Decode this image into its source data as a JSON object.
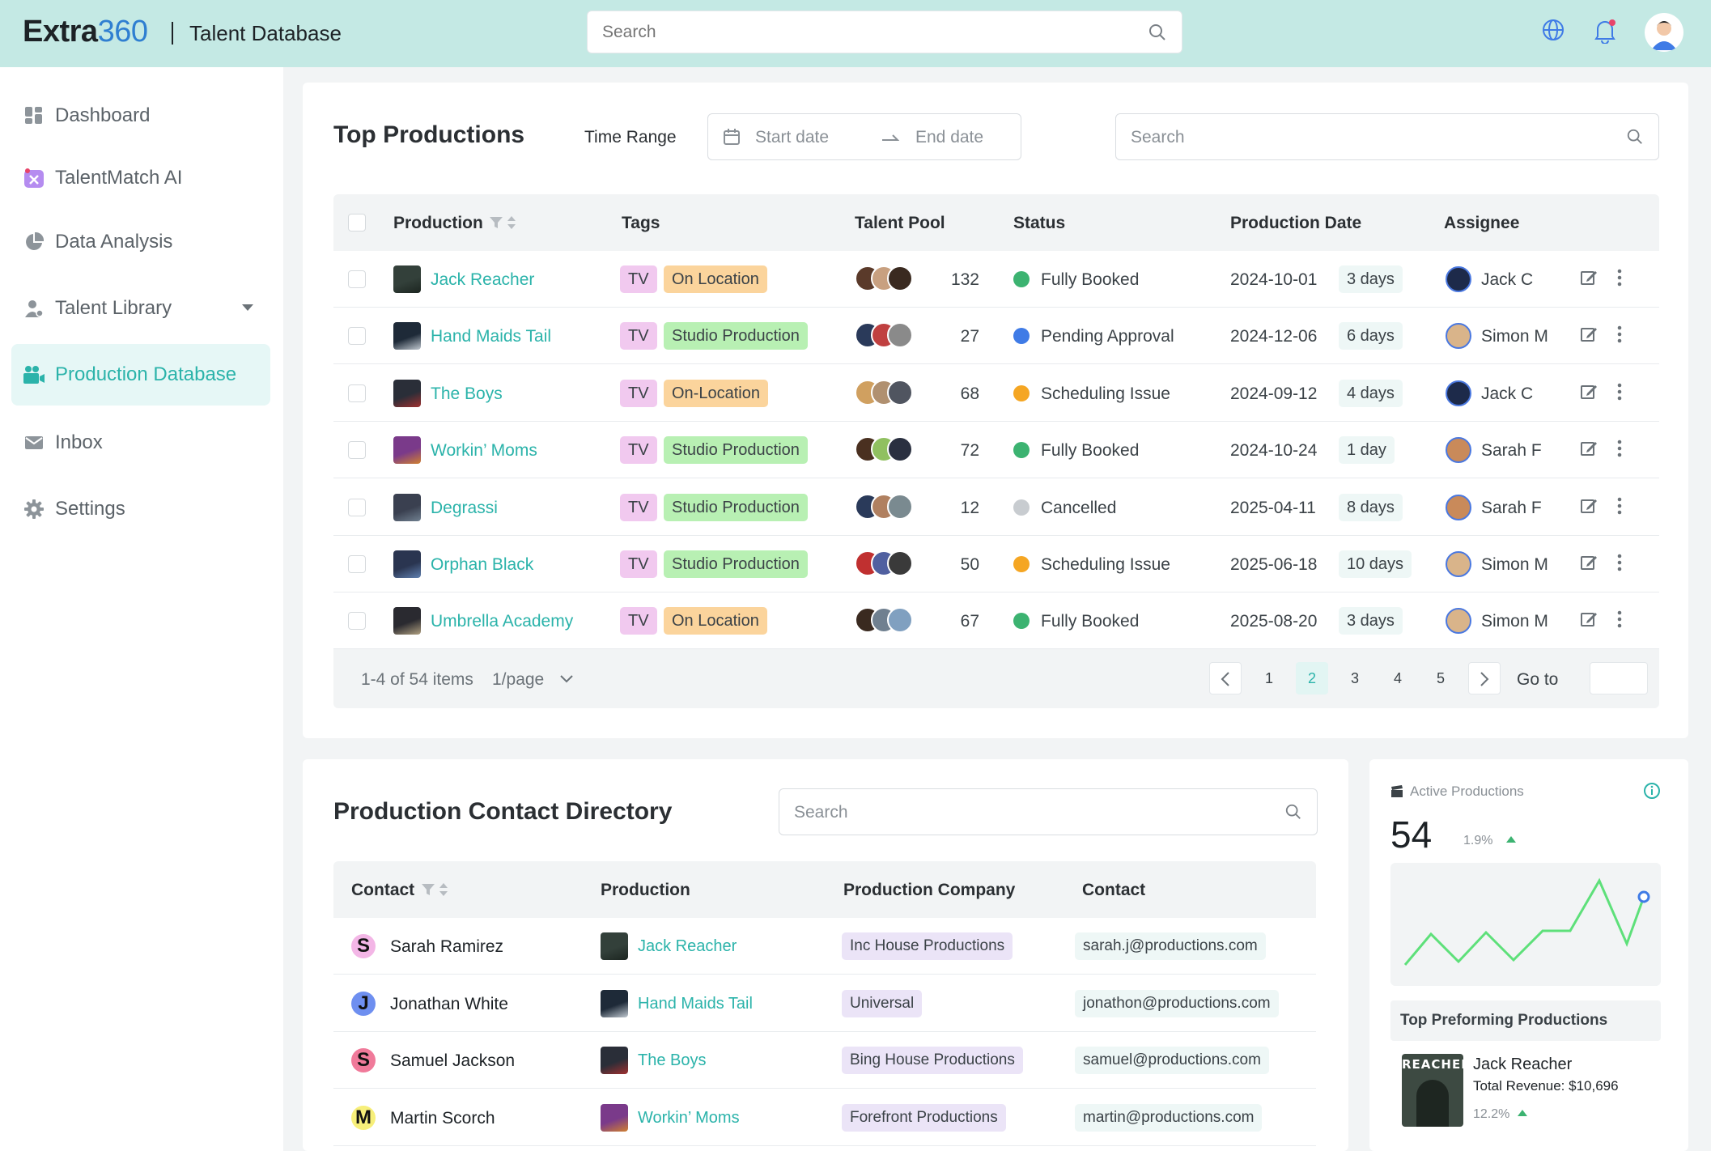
{
  "header": {
    "brand_text": "Extra",
    "brand_num": "360",
    "section": "Talent Database",
    "search_placeholder": "Search"
  },
  "sidebar": {
    "items": [
      {
        "label": "Dashboard",
        "icon": "dashboard-icon"
      },
      {
        "label": "TalentMatch AI",
        "icon": "ai-icon"
      },
      {
        "label": "Data Analysis",
        "icon": "pie-chart-icon"
      },
      {
        "label": "Talent Library",
        "icon": "person-icon"
      },
      {
        "label": "Production Database",
        "icon": "camera-icon"
      },
      {
        "label": "Inbox",
        "icon": "mail-icon"
      },
      {
        "label": "Settings",
        "icon": "gear-icon"
      }
    ]
  },
  "top_productions": {
    "title": "Top Productions",
    "time_range_label": "Time Range",
    "start_placeholder": "Start date",
    "end_placeholder": "End date",
    "search_placeholder": "Search",
    "columns": [
      "Production",
      "Tags",
      "Talent Pool",
      "Status",
      "Production Date",
      "Assignee"
    ],
    "rows": [
      {
        "production": "Jack Reacher",
        "tag1": "TV",
        "tag2": "On Location",
        "tag2_type": "loc",
        "pool": "132",
        "status": "Fully Booked",
        "status_type": "ok",
        "date": "2024-10-01",
        "days": "3 days",
        "assignee": "Jack C"
      },
      {
        "production": "Hand Maids Tail",
        "tag1": "TV",
        "tag2": "Studio Production",
        "tag2_type": "studio",
        "pool": "27",
        "status": "Pending Approval",
        "status_type": "pending",
        "date": "2024-12-06",
        "days": "6 days",
        "assignee": "Simon M"
      },
      {
        "production": "The Boys",
        "tag1": "TV",
        "tag2": "On-Location",
        "tag2_type": "loc",
        "pool": "68",
        "status": "Scheduling Issue",
        "status_type": "warn",
        "date": "2024-09-12",
        "days": "4 days",
        "assignee": "Jack C"
      },
      {
        "production": "Workin’ Moms",
        "tag1": "TV",
        "tag2": "Studio Production",
        "tag2_type": "studio",
        "pool": "72",
        "status": "Fully Booked",
        "status_type": "ok",
        "date": "2024-10-24",
        "days": "1 day",
        "assignee": "Sarah F"
      },
      {
        "production": "Degrassi",
        "tag1": "TV",
        "tag2": "Studio Production",
        "tag2_type": "studio",
        "pool": "12",
        "status": "Cancelled",
        "status_type": "cancel",
        "date": "2025-04-11",
        "days": "8 days",
        "assignee": "Sarah F"
      },
      {
        "production": "Orphan Black",
        "tag1": "TV",
        "tag2": "Studio Production",
        "tag2_type": "studio",
        "pool": "50",
        "status": "Scheduling Issue",
        "status_type": "warn",
        "date": "2025-06-18",
        "days": "10 days",
        "assignee": "Simon M"
      },
      {
        "production": "Umbrella Academy",
        "tag1": "TV",
        "tag2": "On Location",
        "tag2_type": "loc",
        "pool": "67",
        "status": "Fully Booked",
        "status_type": "ok",
        "date": "2025-08-20",
        "days": "3 days",
        "assignee": "Simon M"
      }
    ],
    "footer": {
      "range": "1-4 of 54 items",
      "per_page": "1/page",
      "pages": [
        "1",
        "2",
        "3",
        "4",
        "5"
      ],
      "current_page": "2",
      "goto": "Go to"
    }
  },
  "contacts": {
    "title": "Production Contact Directory",
    "search_placeholder": "Search",
    "columns": [
      "Contact",
      "Production",
      "Production Company",
      "Contact"
    ],
    "rows": [
      {
        "initial": "S",
        "name": "Sarah Ramirez",
        "production": "Jack Reacher",
        "company": "Inc House Productions",
        "email": "sarah.j@productions.com",
        "color": "#f3b6e6"
      },
      {
        "initial": "J",
        "name": "Jonathan White",
        "production": "Hand Maids Tail",
        "company": "Universal",
        "email": "jonathon@productions.com",
        "color": "#6e8ff0"
      },
      {
        "initial": "S",
        "name": "Samuel Jackson",
        "production": "The Boys",
        "company": "Bing House Productions",
        "email": "samuel@productions.com",
        "color": "#f07a9a"
      },
      {
        "initial": "M",
        "name": "Martin Scorch",
        "production": "Workin’ Moms",
        "company": "Forefront Productions",
        "email": "martin@productions.com",
        "color": "#f7ef7a"
      }
    ]
  },
  "kpi": {
    "label": "Active Productions",
    "value": "54",
    "change": "1.9%",
    "top_title": "Top Preforming Productions",
    "top_name": "Jack Reacher",
    "top_revenue": "Total Revenue: $10,696",
    "top_change": "12.2%",
    "poster_text": "REACHER"
  },
  "colors": {
    "accent": "#2bb3aa",
    "header_bg": "#c4e9e4",
    "ok": "#3cb371",
    "pending": "#3f7be6",
    "warn": "#f5a623",
    "cancel": "#c8ccd0"
  }
}
